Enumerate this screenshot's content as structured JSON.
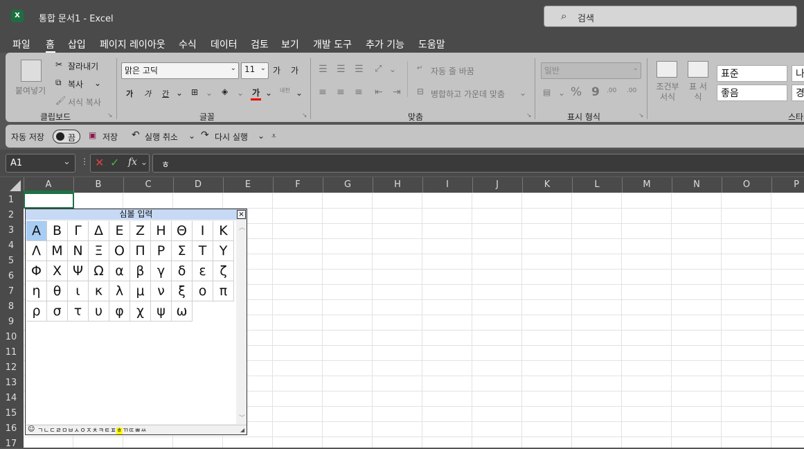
{
  "titlebar": {
    "logo": "X",
    "title": "통합 문서1  -  Excel",
    "search_placeholder": "검색"
  },
  "menu": [
    "파일",
    "홈",
    "삽입",
    "페이지 레이아웃",
    "수식",
    "데이터",
    "검토",
    "보기",
    "개발 도구",
    "추가 기능",
    "도움말"
  ],
  "ribbon": {
    "clipboard": {
      "paste": "붙여넣기",
      "cut": "잘라내기",
      "copy": "복사",
      "format_painter": "서식 복사",
      "label": "클립보드"
    },
    "font": {
      "name": "맑은 고딕",
      "size": "11",
      "grow": "가",
      "shrink": "가",
      "bold": "가",
      "italic": "가",
      "underline": "간",
      "color_label": "가",
      "phonetic": "내천",
      "label": "글꼴"
    },
    "alignment": {
      "wrap": "자동 줄 바꿈",
      "merge": "병합하고 가운데 맞춤",
      "label": "맞춤"
    },
    "number": {
      "format": "일반",
      "label": "표시 형식",
      "inc": ".00",
      "dec": ".00"
    },
    "styles": {
      "conditional": "조건부 서식",
      "table": "표 서식",
      "standard": "표준",
      "good": "좋음",
      "truncated1": "나",
      "truncated2": "경",
      "label": "스타"
    }
  },
  "qat": {
    "autosave": "자동 저장",
    "toggle_state": "끔",
    "save": "저장",
    "undo": "실행 취소",
    "redo": "다시 실행"
  },
  "formula_bar": {
    "name_box": "A1",
    "fx": "fx",
    "content": "ㅎ"
  },
  "columns": [
    "A",
    "B",
    "C",
    "D",
    "E",
    "F",
    "G",
    "H",
    "I",
    "J",
    "K",
    "L",
    "M",
    "N",
    "O",
    "P"
  ],
  "rows": [
    "1",
    "2",
    "3",
    "4",
    "5",
    "6",
    "7",
    "8",
    "9",
    "10",
    "11",
    "12",
    "13",
    "14",
    "15",
    "16",
    "17"
  ],
  "symbol_window": {
    "title": "심볼 입력",
    "close": "×",
    "symbols": [
      "Α",
      "Β",
      "Γ",
      "Δ",
      "Ε",
      "Ζ",
      "Η",
      "Θ",
      "Ι",
      "Κ",
      "Λ",
      "Μ",
      "Ν",
      "Ξ",
      "Ο",
      "Π",
      "Ρ",
      "Σ",
      "Τ",
      "Υ",
      "Φ",
      "Χ",
      "Ψ",
      "Ω",
      "α",
      "β",
      "γ",
      "δ",
      "ε",
      "ζ",
      "η",
      "θ",
      "ι",
      "κ",
      "λ",
      "μ",
      "ν",
      "ξ",
      "ο",
      "π",
      "ρ",
      "σ",
      "τ",
      "υ",
      "φ",
      "χ",
      "ψ",
      "ω"
    ],
    "selected_index": 0,
    "jamo_before": "ㄱㄴㄷㄹㅁㅂㅅㅇㅈㅊㅋㅌㅍ",
    "jamo_selected": "ㅎ",
    "jamo_after": "ㄲㄸㅃㅆ",
    "emoji": "☺"
  },
  "colors": {
    "accent": "#1e7145",
    "selection": "#a7cdf5",
    "highlight": "#ffff00",
    "titlebar": "#4a4a4a",
    "ribbon": "#c4c4c4"
  }
}
